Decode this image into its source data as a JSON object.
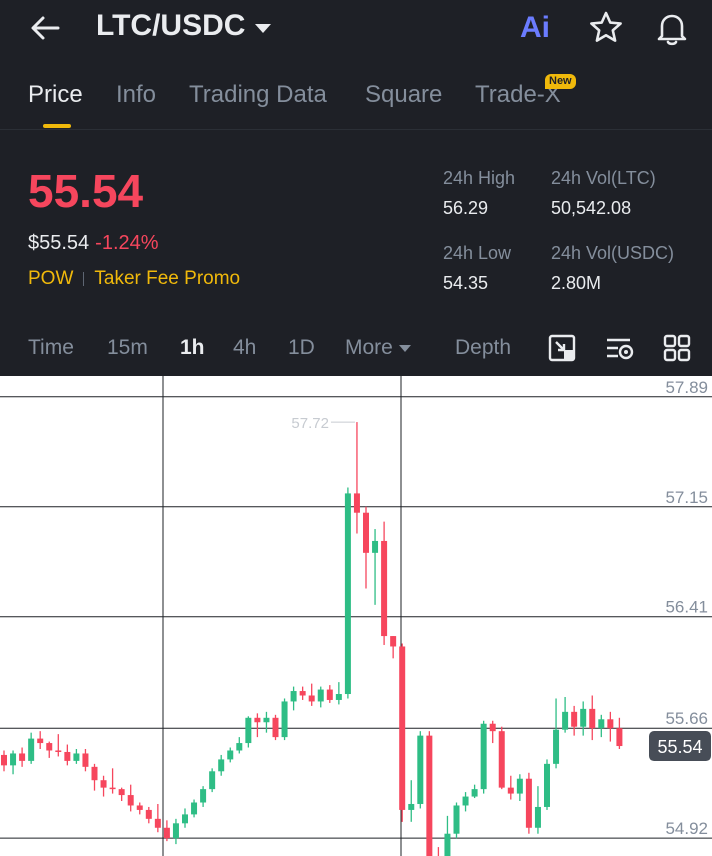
{
  "header": {
    "pair": "LTC/USDC",
    "ai_label": "Ai"
  },
  "tabs": [
    {
      "label": "Price",
      "active": true
    },
    {
      "label": "Info",
      "active": false
    },
    {
      "label": "Trading Data",
      "active": false
    },
    {
      "label": "Square",
      "active": false
    },
    {
      "label": "Trade-X",
      "active": false,
      "badge": "New"
    }
  ],
  "ticker": {
    "last_price": "55.54",
    "usd_price": "$55.54",
    "change": "-1.24%",
    "tag_pow": "POW",
    "tag_promo": "Taker Fee Promo"
  },
  "stats": {
    "high_label": "24h High",
    "high_value": "56.29",
    "vol_ltc_label": "24h Vol(LTC)",
    "vol_ltc_value": "50,542.08",
    "low_label": "24h Low",
    "low_value": "54.35",
    "vol_usdc_label": "24h Vol(USDC)",
    "vol_usdc_value": "2.80M"
  },
  "intervals": {
    "time": "Time",
    "m15": "15m",
    "h1": "1h",
    "h4": "4h",
    "d1": "1D",
    "more": "More",
    "depth": "Depth"
  },
  "colors": {
    "up": "#2ebd85",
    "down": "#f6465d",
    "accent": "#f0b90b",
    "background": "#1e2026"
  },
  "chart_data": {
    "type": "candlestick",
    "price_ticks": [
      57.89,
      57.15,
      56.41,
      55.66,
      54.92
    ],
    "ylim": [
      54.8,
      58.03
    ],
    "current_price_label": "55.54",
    "max_annotation": "57.72",
    "candles": [
      [
        55.48,
        55.41,
        55.51,
        55.37
      ],
      [
        55.41,
        55.49,
        55.51,
        55.35
      ],
      [
        55.49,
        55.44,
        55.53,
        55.4
      ],
      [
        55.44,
        55.59,
        55.63,
        55.42
      ],
      [
        55.59,
        55.56,
        55.64,
        55.52
      ],
      [
        55.56,
        55.51,
        55.57,
        55.46
      ],
      [
        55.51,
        55.5,
        55.62,
        55.47
      ],
      [
        55.5,
        55.44,
        55.55,
        55.41
      ],
      [
        55.44,
        55.49,
        55.52,
        55.42
      ],
      [
        55.49,
        55.4,
        55.52,
        55.37
      ],
      [
        55.4,
        55.31,
        55.42,
        55.24
      ],
      [
        55.31,
        55.26,
        55.34,
        55.2
      ],
      [
        55.26,
        55.25,
        55.39,
        55.22
      ],
      [
        55.25,
        55.21,
        55.26,
        55.17
      ],
      [
        55.21,
        55.14,
        55.28,
        55.1
      ],
      [
        55.14,
        55.11,
        55.16,
        55.08
      ],
      [
        55.11,
        55.05,
        55.13,
        55.02
      ],
      [
        55.05,
        54.99,
        55.15,
        54.96
      ],
      [
        54.99,
        54.92,
        55.04,
        54.9
      ],
      [
        54.92,
        55.02,
        55.05,
        54.88
      ],
      [
        55.02,
        55.08,
        55.12,
        54.99
      ],
      [
        55.08,
        55.16,
        55.18,
        55.06
      ],
      [
        55.16,
        55.25,
        55.27,
        55.13
      ],
      [
        55.25,
        55.37,
        55.39,
        55.23
      ],
      [
        55.37,
        55.45,
        55.48,
        55.34
      ],
      [
        55.45,
        55.51,
        55.53,
        55.43
      ],
      [
        55.51,
        55.56,
        55.6,
        55.49
      ],
      [
        55.56,
        55.73,
        55.74,
        55.53
      ],
      [
        55.73,
        55.7,
        55.76,
        55.6
      ],
      [
        55.7,
        55.73,
        55.77,
        55.63
      ],
      [
        55.73,
        55.6,
        55.75,
        55.58
      ],
      [
        55.6,
        55.84,
        55.86,
        55.58
      ],
      [
        55.84,
        55.91,
        55.94,
        55.78
      ],
      [
        55.91,
        55.88,
        55.94,
        55.85
      ],
      [
        55.88,
        55.84,
        55.96,
        55.81
      ],
      [
        55.84,
        55.92,
        55.94,
        55.8
      ],
      [
        55.92,
        55.85,
        55.95,
        55.83
      ],
      [
        55.85,
        55.89,
        55.97,
        55.82
      ],
      [
        55.89,
        57.24,
        57.28,
        55.86
      ],
      [
        57.24,
        57.11,
        57.72,
        56.97
      ],
      [
        57.11,
        56.84,
        57.15,
        56.6
      ],
      [
        56.84,
        56.92,
        57.0,
        56.49
      ],
      [
        56.92,
        56.28,
        57.05,
        56.22
      ],
      [
        56.28,
        56.21,
        56.28,
        56.13
      ],
      [
        56.21,
        55.11,
        56.23,
        55.03
      ],
      [
        55.11,
        55.15,
        55.31,
        55.03
      ],
      [
        55.15,
        55.61,
        55.64,
        55.12
      ],
      [
        55.61,
        54.79,
        55.64,
        54.79
      ],
      [
        54.79,
        54.78,
        54.86,
        54.78
      ],
      [
        54.78,
        54.95,
        55.07,
        54.78
      ],
      [
        54.95,
        55.14,
        55.16,
        54.92
      ],
      [
        55.14,
        55.2,
        55.23,
        55.1
      ],
      [
        55.2,
        55.25,
        55.28,
        55.19
      ],
      [
        55.25,
        55.69,
        55.71,
        55.22
      ],
      [
        55.69,
        55.64,
        55.71,
        55.56
      ],
      [
        55.64,
        55.26,
        55.67,
        55.25
      ],
      [
        55.26,
        55.22,
        55.34,
        55.18
      ],
      [
        55.22,
        55.32,
        55.35,
        55.17
      ],
      [
        55.32,
        54.99,
        55.36,
        54.95
      ],
      [
        54.99,
        55.13,
        55.27,
        54.95
      ],
      [
        55.13,
        55.42,
        55.45,
        55.11
      ],
      [
        55.42,
        55.65,
        55.86,
        55.39
      ],
      [
        55.65,
        55.77,
        55.87,
        55.63
      ],
      [
        55.77,
        55.67,
        55.81,
        55.61
      ],
      [
        55.67,
        55.79,
        55.84,
        55.61
      ],
      [
        55.79,
        55.66,
        55.88,
        55.58
      ],
      [
        55.66,
        55.72,
        55.75,
        55.6
      ],
      [
        55.72,
        55.66,
        55.77,
        55.57
      ],
      [
        55.66,
        55.54,
        55.73,
        55.52
      ]
    ]
  }
}
